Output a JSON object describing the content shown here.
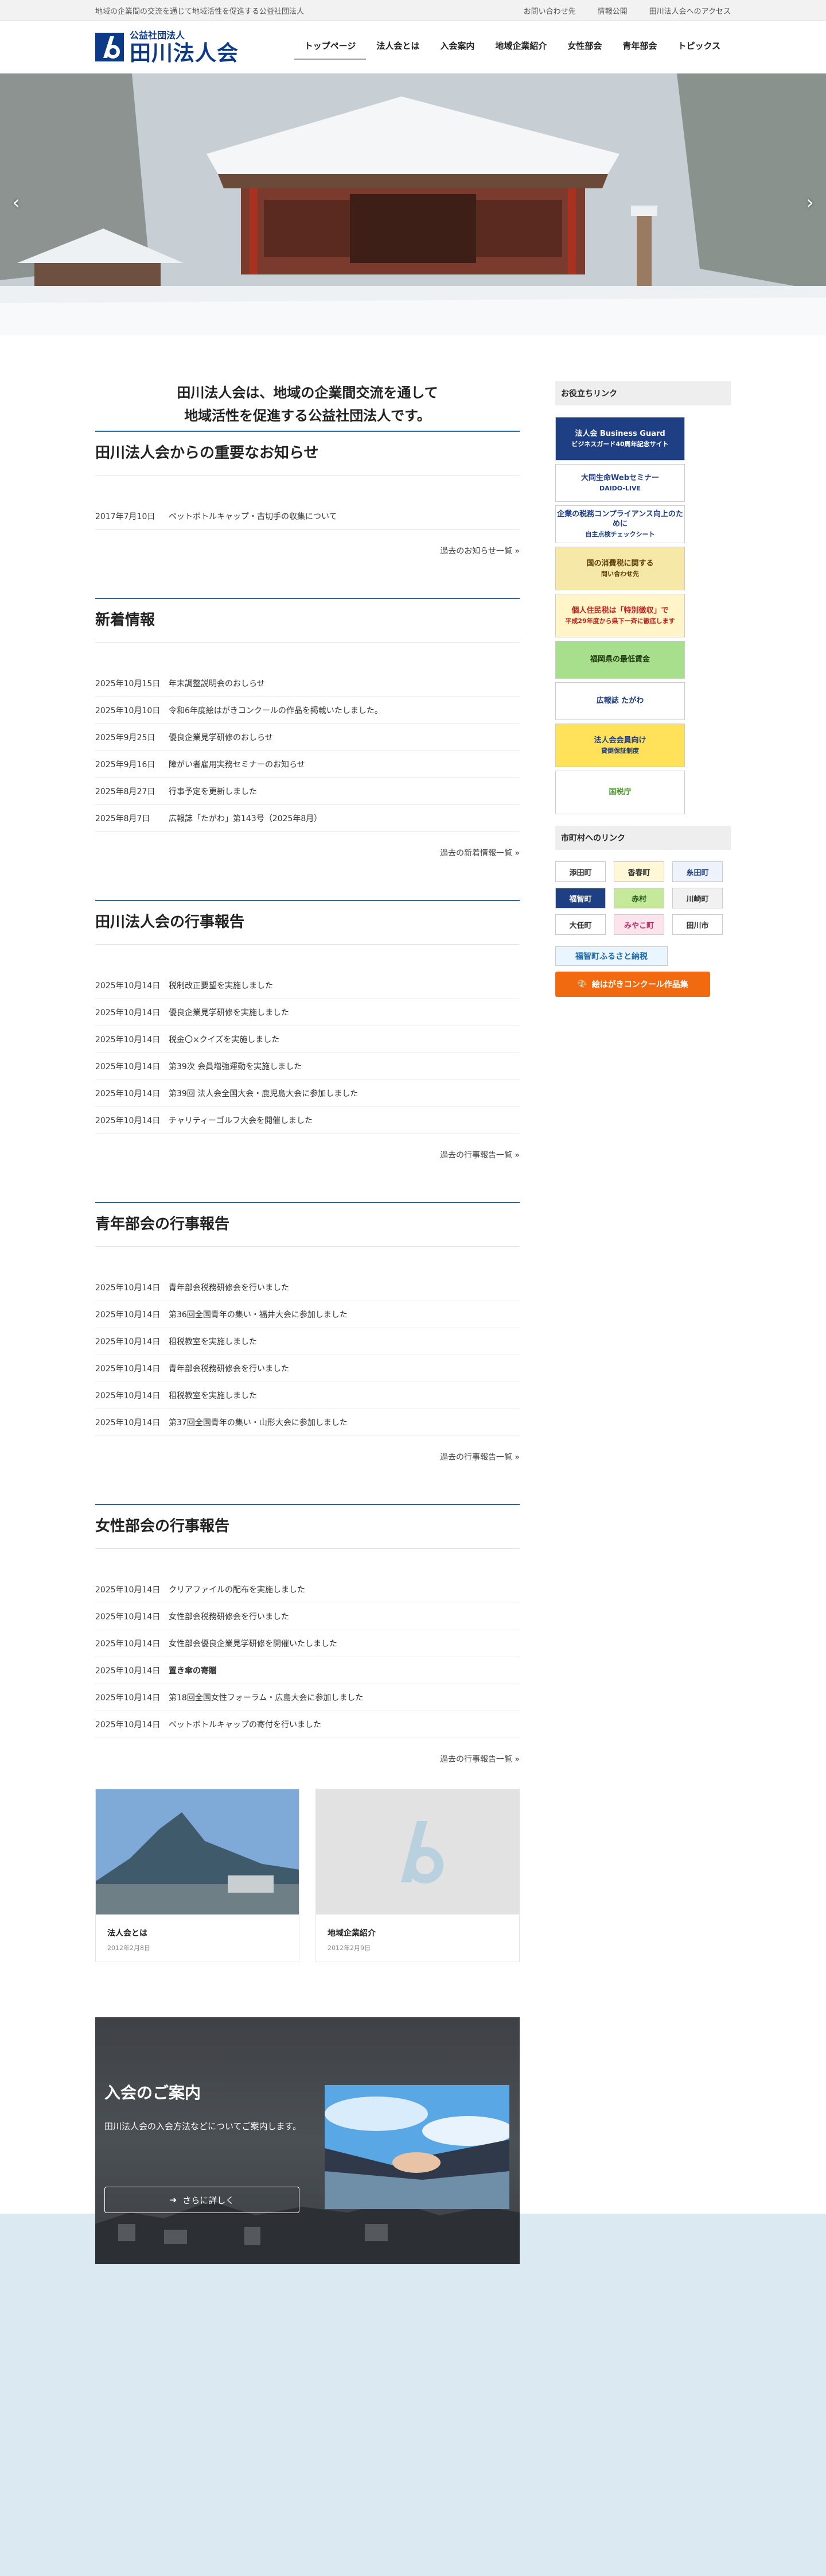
{
  "topbar": {
    "tagline": "地域の企業間の交流を通じて地域活性を促進する公益社団法人",
    "links": [
      "お問い合わせ先",
      "情報公開",
      "田川法人会へのアクセス"
    ]
  },
  "logo": {
    "sub": "公益社団法人",
    "main": "田川法人会"
  },
  "nav": [
    "トップページ",
    "法人会とは",
    "入会案内",
    "地域企業紹介",
    "女性部会",
    "青年部会",
    "トピックス"
  ],
  "hero": {
    "prev": "‹",
    "next": "›"
  },
  "tagline": [
    "田川法人会は、地域の企業間交流を通して",
    "地域活性を促進する公益社団法人です。"
  ],
  "sections": [
    {
      "title": "田川法人会からの重要なお知らせ",
      "rows": [
        {
          "date": "2017年7月10日",
          "title": "ペットボトルキャップ・古切手の収集について"
        }
      ],
      "more": "過去のお知らせ一覧 »"
    },
    {
      "title": "新着情報",
      "rows": [
        {
          "date": "2025年10月15日",
          "title": "年末調整説明会のおしらせ"
        },
        {
          "date": "2025年10月10日",
          "title": "令和6年度絵はがきコンクールの作品を掲載いたしました。"
        },
        {
          "date": "2025年9月25日",
          "title": "優良企業見学研修のおしらせ"
        },
        {
          "date": "2025年9月16日",
          "title": "障がい者雇用実務セミナーのお知らせ"
        },
        {
          "date": "2025年8月27日",
          "title": "行事予定を更新しました"
        },
        {
          "date": "2025年8月7日",
          "title": "広報誌「たがわ」第143号（2025年8月）"
        }
      ],
      "more": "過去の新着情報一覧 »"
    },
    {
      "title": "田川法人会の行事報告",
      "rows": [
        {
          "date": "2025年10月14日",
          "title": "税制改正要望を実施しました"
        },
        {
          "date": "2025年10月14日",
          "title": "優良企業見学研修を実施しました"
        },
        {
          "date": "2025年10月14日",
          "title": "税金〇×クイズを実施しました"
        },
        {
          "date": "2025年10月14日",
          "title": "第39次 会員増強運動を実施しました"
        },
        {
          "date": "2025年10月14日",
          "title": "第39回 法人会全国大会・鹿児島大会に参加しました"
        },
        {
          "date": "2025年10月14日",
          "title": "チャリティーゴルフ大会を開催しました"
        }
      ],
      "more": "過去の行事報告一覧 »"
    },
    {
      "title": "青年部会の行事報告",
      "rows": [
        {
          "date": "2025年10月14日",
          "title": "青年部会税務研修会を行いました"
        },
        {
          "date": "2025年10月14日",
          "title": "第36回全国青年の集い・福井大会に参加しました"
        },
        {
          "date": "2025年10月14日",
          "title": "租税教室を実施しました"
        },
        {
          "date": "2025年10月14日",
          "title": "青年部会税務研修会を行いました"
        },
        {
          "date": "2025年10月14日",
          "title": "租税教室を実施しました"
        },
        {
          "date": "2025年10月14日",
          "title": "第37回全国青年の集い・山形大会に参加しました"
        }
      ],
      "more": "過去の行事報告一覧 »"
    },
    {
      "title": "女性部会の行事報告",
      "rows": [
        {
          "date": "2025年10月14日",
          "title": "クリアファイルの配布を実施しました"
        },
        {
          "date": "2025年10月14日",
          "title": "女性部会税務研修会を行いました"
        },
        {
          "date": "2025年10月14日",
          "title": "女性部会優良企業見学研修を開催いたしました"
        },
        {
          "date": "2025年10月14日",
          "title": "置き傘の寄贈",
          "bold": true
        },
        {
          "date": "2025年10月14日",
          "title": "第18回全国女性フォーラム・広島大会に参加しました"
        },
        {
          "date": "2025年10月14日",
          "title": "ペットボトルキャップの寄付を行いました"
        }
      ],
      "more": "過去の行事報告一覧 »"
    }
  ],
  "cards": [
    {
      "title": "法人会とは",
      "date": "2012年2月8日"
    },
    {
      "title": "地域企業紹介",
      "date": "2012年2月9日"
    }
  ],
  "join": {
    "title": "入会のご案内",
    "text": "田川法人会の入会方法などについてご案内します。",
    "button": "さらに詳しく"
  },
  "side": {
    "head1": "お役立ちリンク",
    "banners": [
      {
        "l1": "法人会 Business Guard",
        "l2": "ビジネスガード40周年記念サイト",
        "bg": "#1f3f85",
        "fg": "#ffffff"
      },
      {
        "l1": "大同生命Webセミナー",
        "l2": "DAIDO-LIVE",
        "bg": "#ffffff",
        "fg": "#1f3f85"
      },
      {
        "l1": "企業の税務コンプライアンス向上のために",
        "l2": "自主点検チェックシート",
        "bg": "#ffffff",
        "fg": "#1f3f85"
      },
      {
        "l1": "国の消費税に関する",
        "l2": "問い合わせ先",
        "bg": "#f6e9a8",
        "fg": "#5a3a00"
      },
      {
        "l1": "個人住民税は「特別徴収」で",
        "l2": "平成29年度から県下一斉に徹底します",
        "bg": "#fff5c9",
        "fg": "#c02020"
      },
      {
        "l1": "福岡県の最低賃金",
        "l2": "",
        "bg": "#a8df8c",
        "fg": "#1e3c10"
      },
      {
        "l1": "広報誌 たがわ",
        "l2": "",
        "bg": "#ffffff",
        "fg": "#1f3f85"
      },
      {
        "l1": "法人会会員向け",
        "l2": "貸倒保証制度",
        "bg": "#ffe15a",
        "fg": "#1f3f85"
      },
      {
        "l1": "国税庁",
        "l2": "",
        "bg": "#ffffff",
        "fg": "#4a9a2a"
      }
    ],
    "head2": "市町村へのリンク",
    "munis": [
      "添田町",
      "香春町",
      "糸田町",
      "福智町",
      "赤村",
      "川崎町",
      "大任町",
      "みやこ町",
      "田川市"
    ],
    "furusato": "福智町ふるさと納税",
    "ehagaki": "絵はがきコンクール作品集"
  }
}
